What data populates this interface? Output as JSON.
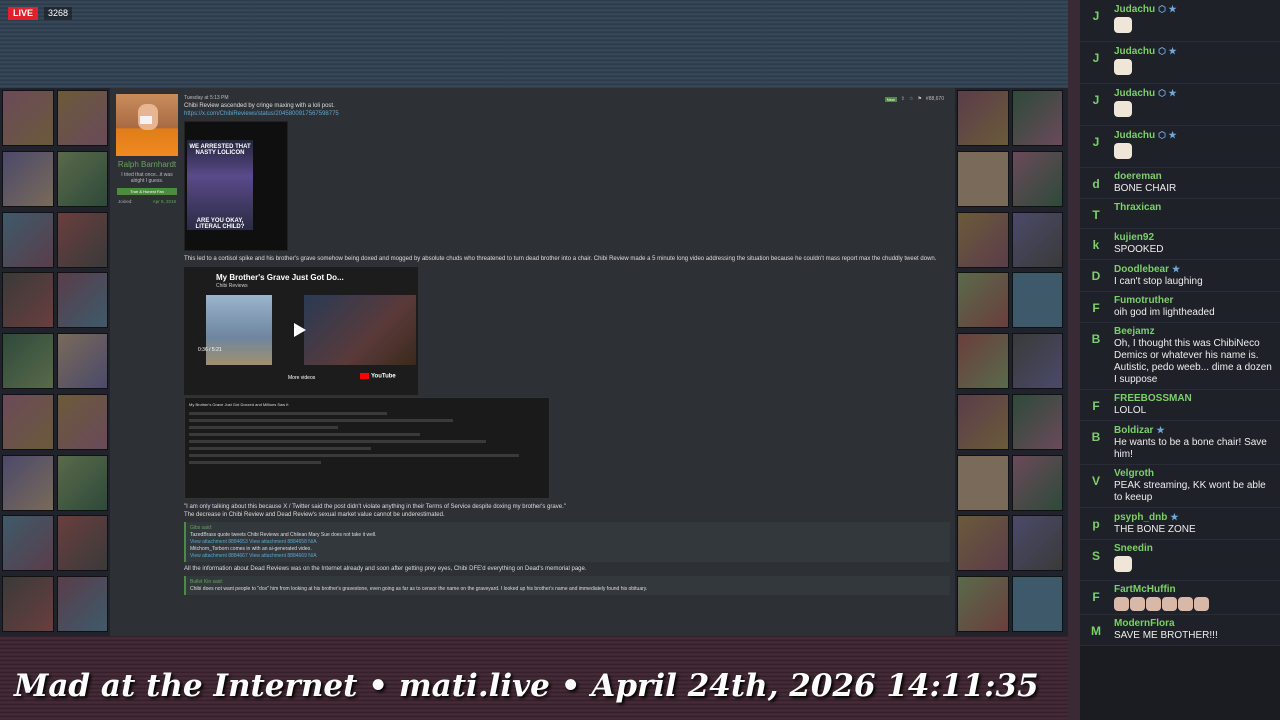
{
  "stream": {
    "live_label": "LIVE",
    "viewers": "3268",
    "ticker": "Mad at the Internet • mati.live • April 24th, 2026 14:11:35"
  },
  "colors": {
    "accent_green": "#62a857",
    "link_blue": "#5aa7d3",
    "live_red": "#e0202a"
  },
  "forum": {
    "user": {
      "name": "Ralph Barnhardt",
      "title": "I tried that once...it was alright I guess.",
      "badge": "True & Honest Fan",
      "joined_label": "Joined:",
      "joined_date": "Apr 8, 2019"
    },
    "post": {
      "timestamp": "Tuesday at 5:13 PM",
      "new_tag": "New",
      "post_number": "#88,670",
      "line1": "Chibi Review ascended by cringe maxing with a loli post.",
      "link1": "https://x.com/ChibiReviews/status/2045800917567598775",
      "tweet_caption_top": "WE ARRESTED THAT NASTY LOLICON",
      "tweet_caption_bottom": "ARE YOU OKAY, LITERAL CHILD?",
      "para2": "This led to a cortisol spike and his brother's grave somehow being doxed and mogged by absolute chuds who threatened to turn dead brother into a chair. Chibi Review made a 5 minute long video addressing the situation because he couldn't mass report max the chuddly tweet down.",
      "video_title": "My Brother's Grave Just Got Do...",
      "video_channel": "Chibi Reviews",
      "video_time": "0:36 / 5:21",
      "more_videos": "More videos",
      "youtube_label": "YouTube",
      "screenshot_title": "My Brother's Grave Just Got Doxxed and Millions Saw It",
      "quote1_intro": "\"I am only talking about this because X / Twitter said the post didn't violate anything in their Terms of Service despite doxing my brother's grave.\"",
      "quote1_follow": "The decrease in Chibi Review and Dead Review's sexual market value cannot be underestimated.",
      "quote_block": {
        "author": "Gibs said:",
        "line1": "TazedBrass quote tweets Chibi Reviews and Chilean Mary Sue does not take it well.",
        "link1": "View attachment 8884653 View attachment 8884658 N/A",
        "line2": "Mitchorn_Torborn comes in with an ai-generated video.",
        "link2": "View attachment 8884667 View attachment 8884669 N/A"
      },
      "para3": "All the information about Dead Reviews was on the Internet already and soon after getting prey eyes, Chibi DFE'd everything on Dead's memorial page.",
      "quote_block2": {
        "author": "Bullet Kin said:",
        "line1": "Chibi does not want people to \"dox\" him from looking at his brother's gravestone, even going as far as to censor the name on the graveyard. I looked up his brother's name and immediately found his obituary."
      }
    }
  },
  "chat": {
    "messages": [
      {
        "initial": "J",
        "name": "Judachu",
        "badges": "⬡ ★",
        "text": "",
        "emote": true
      },
      {
        "initial": "J",
        "name": "Judachu",
        "badges": "⬡ ★",
        "text": "",
        "emote": true
      },
      {
        "initial": "J",
        "name": "Judachu",
        "badges": "⬡ ★",
        "text": "",
        "emote": true
      },
      {
        "initial": "J",
        "name": "Judachu",
        "badges": "⬡ ★",
        "text": "",
        "emote": true
      },
      {
        "initial": "d",
        "name": "doereman",
        "badges": "",
        "text": "BONE CHAIR",
        "emote": false
      },
      {
        "initial": "T",
        "name": "Thraxican",
        "badges": "",
        "text": "",
        "emote": false
      },
      {
        "initial": "k",
        "name": "kujien92",
        "badges": "",
        "text": "SPOOKED",
        "emote": false
      },
      {
        "initial": "D",
        "name": "Doodlebear",
        "badges": "★",
        "text": "I can't stop laughing",
        "emote": false
      },
      {
        "initial": "F",
        "name": "Fumotruther",
        "badges": "",
        "text": "oih god im lightheaded",
        "emote": false
      },
      {
        "initial": "B",
        "name": "Beejamz",
        "badges": "",
        "text": "Oh, I thought this was ChibiNeco Demics or whatever his name is. Autistic, pedo weeb... dime a dozen I suppose",
        "emote": false
      },
      {
        "initial": "F",
        "name": "FREEBOSSMAN",
        "badges": "",
        "text": "LOLOL",
        "emote": false
      },
      {
        "initial": "B",
        "name": "Boldizar",
        "badges": "★",
        "text": "He wants to be a bone chair! Save him!",
        "emote": false
      },
      {
        "initial": "V",
        "name": "Velgroth",
        "badges": "",
        "text": "PEAK streaming, KK wont be able to keeup",
        "emote": false
      },
      {
        "initial": "p",
        "name": "psyph_dnb",
        "badges": "★",
        "text": "THE BONE ZONE",
        "emote": false
      },
      {
        "initial": "S",
        "name": "Sneedin",
        "badges": "",
        "text": "",
        "emote": true
      },
      {
        "initial": "F",
        "name": "FartMcHuffin",
        "badges": "",
        "text": "",
        "emote": "row"
      },
      {
        "initial": "M",
        "name": "ModernFlora",
        "badges": "",
        "text": "SAVE ME BROTHER!!!",
        "emote": false
      }
    ]
  }
}
